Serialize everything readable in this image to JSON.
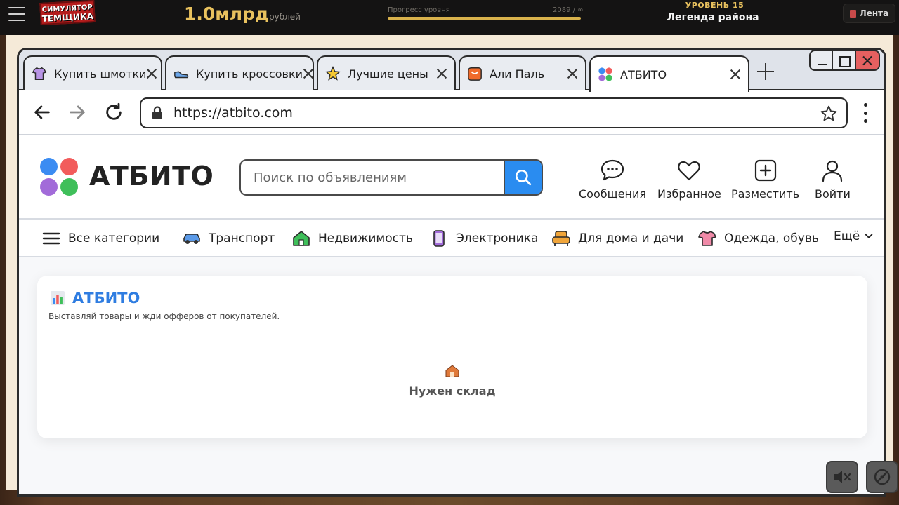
{
  "game": {
    "logo_line1": "СИМУЛЯТОР",
    "logo_line2": "ТЕМЩИКА",
    "money": "1.0млрд",
    "money_unit": "рублей",
    "progress_label": "Прогресс уровня",
    "progress_value": "2089 / ∞",
    "progress_fraction": 1.0,
    "level_title": "УРОВЕНЬ 15",
    "level_name": "Легенда района",
    "feed_label": "Лента"
  },
  "browser": {
    "tabs": [
      {
        "label": "Купить шмотки",
        "icon": "tshirt-icon",
        "active": false
      },
      {
        "label": "Купить кроссовки",
        "icon": "sneaker-icon",
        "active": false
      },
      {
        "label": "Лучшие цены",
        "icon": "star-icon",
        "active": false
      },
      {
        "label": "Али Паль",
        "icon": "shopping-bag-icon",
        "active": false
      },
      {
        "label": "АТБИТО",
        "icon": "atbito-dots-icon",
        "active": true
      }
    ],
    "url": "https://atbito.com"
  },
  "site": {
    "brand": "АТБИТО",
    "search_placeholder": "Поиск по объявлениям",
    "actions": {
      "messages": "Сообщения",
      "favorites": "Избранное",
      "post": "Разместить",
      "login": "Войти"
    },
    "categories": {
      "all": "Все категории",
      "transport": "Транспорт",
      "realty": "Недвижимость",
      "electronics": "Электроника",
      "home": "Для дома и дачи",
      "clothes": "Одежда, обувь",
      "more": "Ещё"
    },
    "brand_colors": [
      "#3b8cf2",
      "#f25c5c",
      "#a26bd9",
      "#3fbf5a"
    ]
  },
  "card": {
    "title": "АТБИТО",
    "subtitle": "Выставляй товары и жди офферов от покупателей.",
    "empty_text": "Нужен склад"
  }
}
